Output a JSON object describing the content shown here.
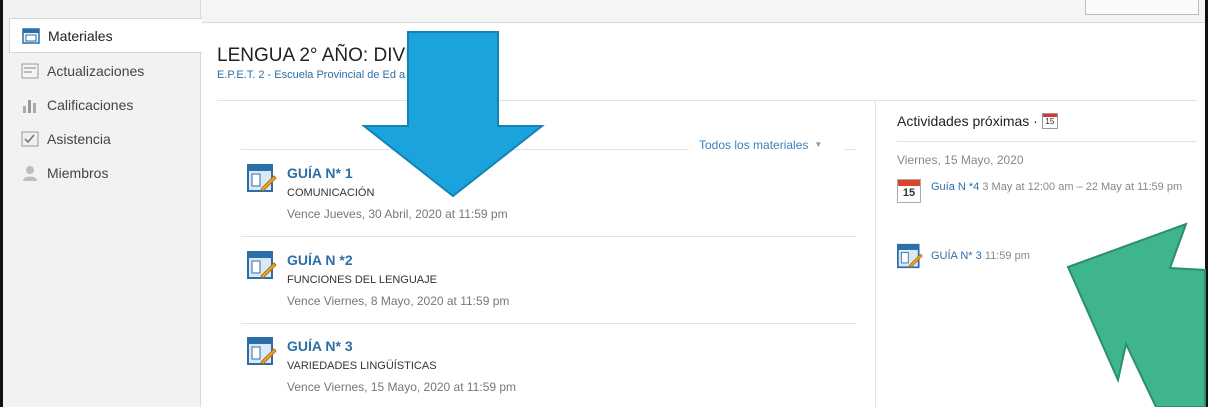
{
  "sidebar": {
    "items": [
      {
        "label": "Materiales",
        "icon": "materials-icon",
        "active": true
      },
      {
        "label": "Actualizaciones",
        "icon": "updates-icon",
        "active": false
      },
      {
        "label": "Calificaciones",
        "icon": "grades-icon",
        "active": false
      },
      {
        "label": "Asistencia",
        "icon": "attendance-icon",
        "active": false
      },
      {
        "label": "Miembros",
        "icon": "members-icon",
        "active": false
      }
    ]
  },
  "course": {
    "title": "LENGUA 2° AÑO: DIVISIÓN 1",
    "school": "E.P.E.T. 2 - Escuela Provincial de Ed                    a"
  },
  "filter": {
    "label": "Todos los materiales"
  },
  "materials": [
    {
      "name": "GUÍA N* 1",
      "description": "COMUNICACIÓN",
      "due": "Vence Jueves, 30 Abril, 2020 at 11:59 pm"
    },
    {
      "name": "GUÍA N *2",
      "description": "FUNCIONES DEL LENGUAJE",
      "due": "Vence Viernes, 8 Mayo, 2020 at 11:59 pm"
    },
    {
      "name": "GUÍA N* 3",
      "description": "VARIEDADES LINGÜÍSTICAS",
      "due": "Vence Viernes, 15 Mayo, 2020 at 11:59 pm"
    }
  ],
  "upcoming": {
    "title": "Actividades próximas ·",
    "calendar_day": "15",
    "date": "Viernes, 15 Mayo, 2020",
    "events": [
      {
        "name": "Guía N *4",
        "time": "3 May at 12:00 am – 22 May at 11:59 pm",
        "calendar_day": "15"
      },
      {
        "name": "GUÍA N* 3",
        "time": "11:59 pm"
      }
    ]
  },
  "colors": {
    "link": "#2e6ea6",
    "blue_arrow": "#1aa3dc",
    "green_arrow": "#3fb58e"
  }
}
